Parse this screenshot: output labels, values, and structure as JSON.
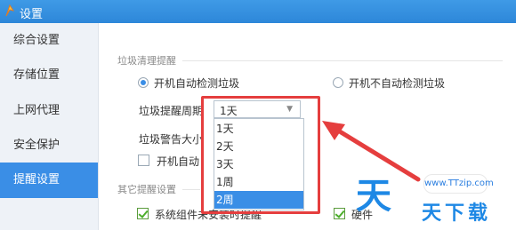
{
  "window": {
    "title": "设置"
  },
  "sidebar": {
    "items": [
      {
        "label": "综合设置"
      },
      {
        "label": "存储位置"
      },
      {
        "label": "上网代理"
      },
      {
        "label": "安全保护"
      },
      {
        "label": "提醒设置",
        "active": true
      }
    ]
  },
  "content": {
    "garbage_section_title": "垃圾清理提醒",
    "radio_auto": "开机自动检测垃圾",
    "radio_no_auto": "开机不自动检测垃圾",
    "period_label": "垃圾提醒周期",
    "period_select": {
      "value": "1天",
      "options": [
        "1天",
        "2天",
        "3天",
        "1周",
        "2周"
      ],
      "highlighted": "2周"
    },
    "warning_size_label": "垃圾警告大小",
    "auto_check_label": "开机自动",
    "other_section_title": "其它提醒设置",
    "check_component": "系统组件未安装时提醒",
    "check_hardware": "硬件"
  },
  "watermark": {
    "logo": "天",
    "url": "www.TTzip.com",
    "text": "天下载"
  },
  "colors": {
    "accent": "#3a8ee6",
    "highlight_red": "#e53e3e"
  }
}
